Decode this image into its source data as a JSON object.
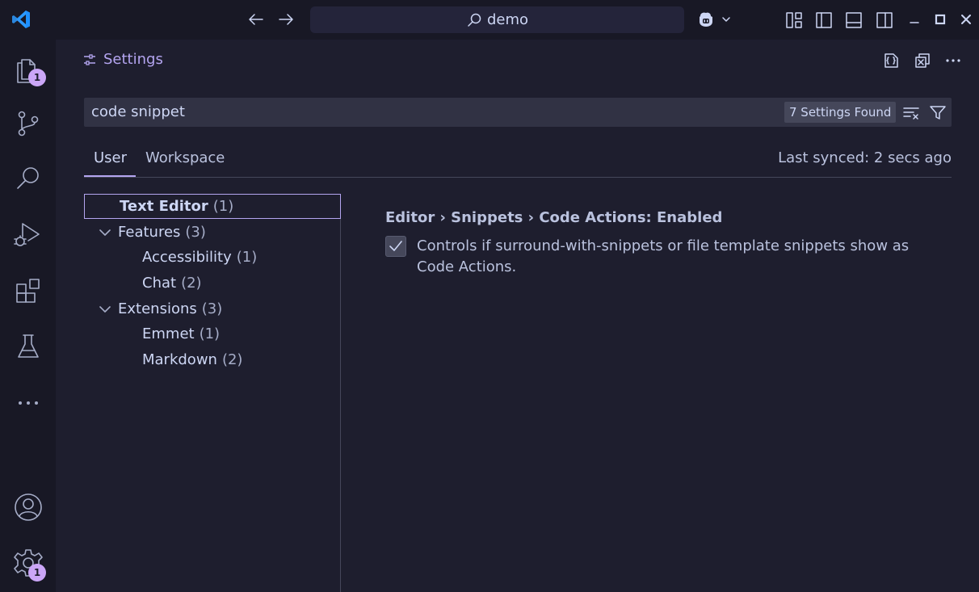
{
  "titlebar": {
    "search_text": "demo"
  },
  "activitybar": {
    "explorer_badge": "1",
    "settings_badge": "1"
  },
  "editor": {
    "title": "Settings"
  },
  "settings": {
    "search_query": "code snippet",
    "found_label": "7 Settings Found",
    "tabs": [
      "User",
      "Workspace"
    ],
    "last_synced": "Last synced: 2 secs ago",
    "toc": [
      {
        "label": "Text Editor",
        "count": "(1)"
      },
      {
        "label": "Features",
        "count": "(3)"
      },
      {
        "label": "Accessibility",
        "count": "(1)"
      },
      {
        "label": "Chat",
        "count": "(2)"
      },
      {
        "label": "Extensions",
        "count": "(3)"
      },
      {
        "label": "Emmet",
        "count": "(1)"
      },
      {
        "label": "Markdown",
        "count": "(2)"
      }
    ],
    "setting": {
      "title": "Editor › Snippets › Code Actions: Enabled",
      "description": "Controls if surround-with-snippets or file template snippets show as Code Actions.",
      "checked": true
    }
  },
  "colors": {
    "accent": "#b4a5f0",
    "badge": "#cba6f7",
    "logo": "#1e90ff"
  }
}
